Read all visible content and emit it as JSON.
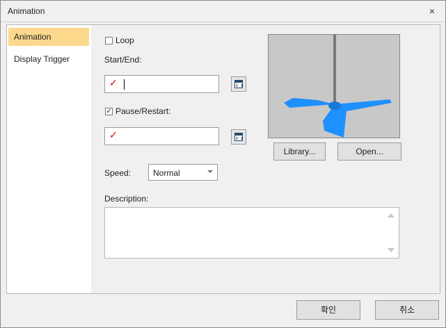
{
  "window": {
    "title": "Animation",
    "close_glyph": "×"
  },
  "sidebar": {
    "items": [
      {
        "label": "Animation",
        "active": true
      },
      {
        "label": "Display Trigger",
        "active": false
      }
    ]
  },
  "loop": {
    "label": "Loop",
    "checked": false
  },
  "start_end": {
    "label": "Start/End:",
    "value": ""
  },
  "pause_restart": {
    "label": "Pause/Restart:",
    "checked": true,
    "value": ""
  },
  "speed": {
    "label": "Speed:",
    "value": "Normal"
  },
  "description": {
    "label": "Description:",
    "value": ""
  },
  "preview": {
    "library_label": "Library...",
    "open_label": "Open..."
  },
  "footer": {
    "ok_label": "확인",
    "cancel_label": "취소"
  },
  "icons": {
    "calendar": "calendar-icon",
    "check_mark": "red-check-icon"
  },
  "colors": {
    "active_nav": "#fcd98d",
    "fan_blue": "#1e90ff"
  }
}
